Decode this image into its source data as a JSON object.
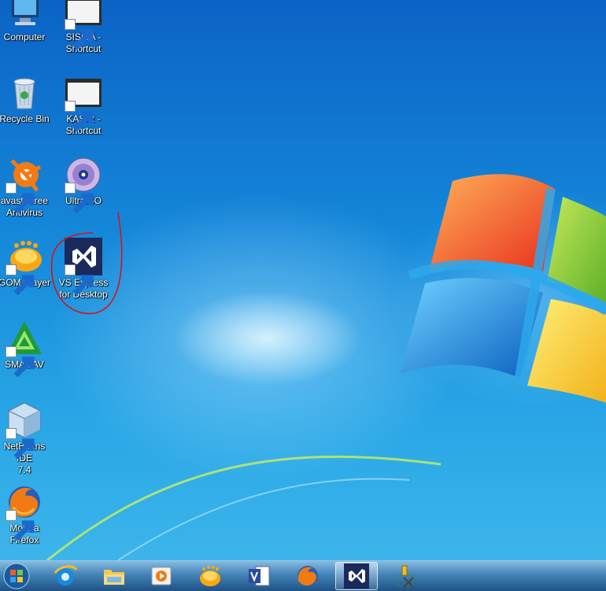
{
  "desktop": {
    "icons": [
      {
        "label": "Computer",
        "icon": "computer-icon"
      },
      {
        "label": "SISWA -\nShortcut",
        "icon": "window-shortcut-icon"
      },
      {
        "label": "Recycle Bin",
        "icon": "recycle-bin-icon"
      },
      {
        "label": "KASIR -\nShortcut",
        "icon": "window-shortcut-icon"
      },
      {
        "label": "avast! Free\nAntivirus",
        "icon": "avast-icon"
      },
      {
        "label": "UltraISO",
        "icon": "ultraiso-disc-icon"
      },
      {
        "label": "GOM Player",
        "icon": "gom-player-icon"
      },
      {
        "label": "VS Express\nfor Desktop",
        "icon": "visual-studio-icon"
      },
      {
        "label": "SMADAV",
        "icon": "smadav-icon"
      },
      {
        "label": "NetBeans IDE\n7.4",
        "icon": "netbeans-icon"
      },
      {
        "label": "Mozilla\nFirefox",
        "icon": "firefox-icon"
      }
    ],
    "annotation_color": "#d4141c"
  },
  "taskbar": {
    "items": [
      {
        "icon": "start-orb-icon"
      },
      {
        "icon": "internet-explorer-icon"
      },
      {
        "icon": "file-explorer-icon"
      },
      {
        "icon": "media-player-icon"
      },
      {
        "icon": "gom-player-icon"
      },
      {
        "icon": "visio-icon"
      },
      {
        "icon": "firefox-icon"
      },
      {
        "icon": "visual-studio-icon",
        "active": true
      },
      {
        "icon": "tools-icon"
      }
    ]
  },
  "colors": {
    "desktop_blue": "#1486d8",
    "vs_purple": "#1b2a5c",
    "taskbar": "#3a7ab4"
  }
}
